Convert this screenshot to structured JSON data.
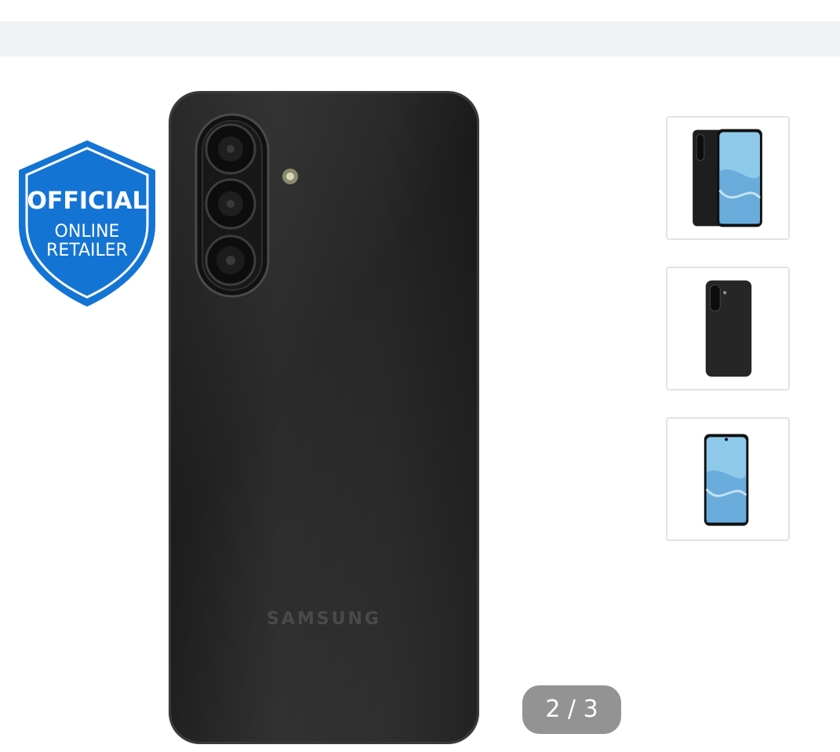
{
  "badge": {
    "line1": "OFFICIAL",
    "line2": "ONLINE",
    "line3": "RETAILER",
    "color": "#1474d4"
  },
  "product": {
    "brand_mark": "SAMSUNG"
  },
  "gallery": {
    "counter": "2 / 3",
    "current_index": 2,
    "total": 3,
    "thumbnails": [
      {
        "icon": "phone-front-back-thumbnail"
      },
      {
        "icon": "phone-back-thumbnail"
      },
      {
        "icon": "phone-front-thumbnail"
      }
    ]
  },
  "colors": {
    "top_bar": "#f1f2f5",
    "counter_bg": "#939393",
    "phone_body": "#262626",
    "screen": "#8ec9ea"
  }
}
